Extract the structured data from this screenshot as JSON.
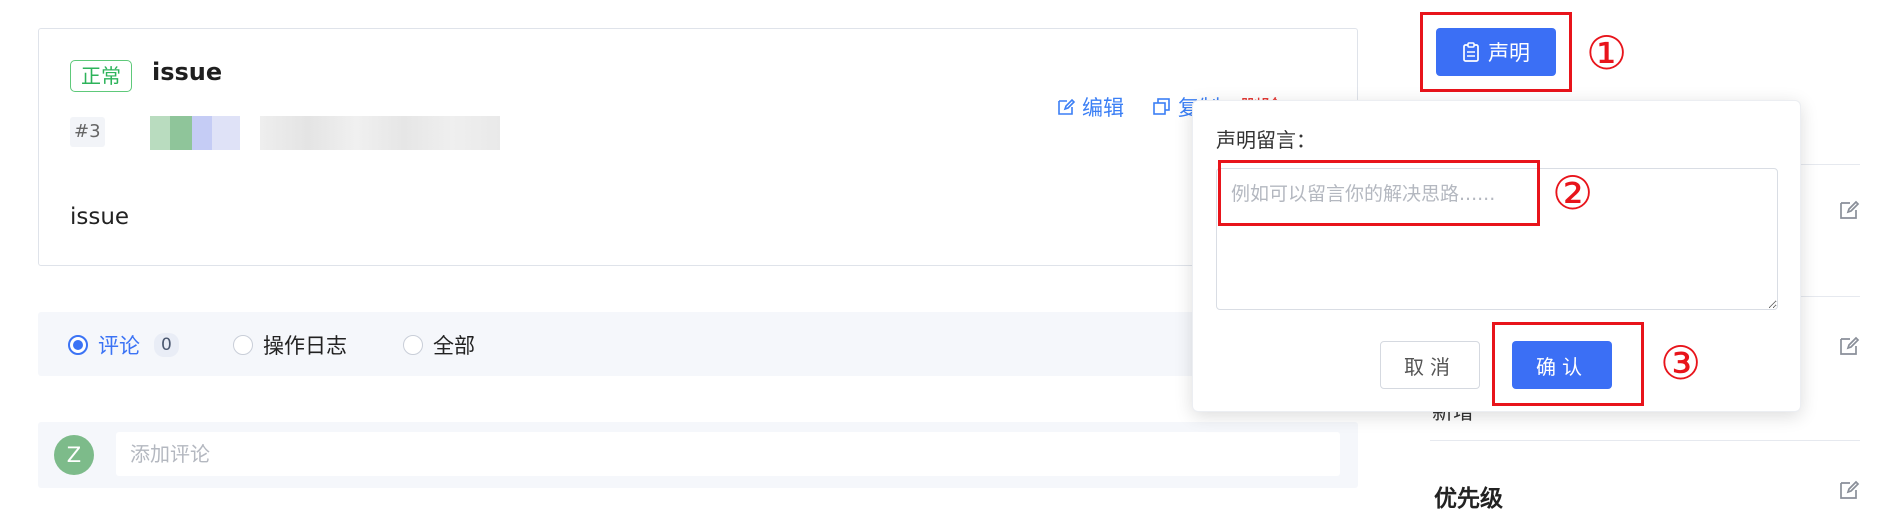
{
  "issue": {
    "status": "正常",
    "title": "issue",
    "number": "#3",
    "body": "issue",
    "edit_label": "编辑",
    "copy_label_partial": "复制",
    "red_action_partial": "删除"
  },
  "comments": {
    "tabs": [
      {
        "label": "评论",
        "count": "0",
        "selected": true
      },
      {
        "label": "操作日志",
        "selected": false
      },
      {
        "label": "全部",
        "selected": false
      }
    ],
    "avatar_letter": "Z",
    "input_placeholder": "添加评论"
  },
  "side_panel": {
    "fragment": "新增",
    "priority_label": "优先级"
  },
  "declare": {
    "button_label": "声明",
    "popover_label": "声明留言：",
    "placeholder": "例如可以留言你的解决思路......",
    "cancel_label": "取消",
    "confirm_label": "确认"
  },
  "annotations": {
    "marker_1": "①",
    "marker_2": "②",
    "marker_3": "③"
  },
  "colors": {
    "primary": "#3b6ff5",
    "status_green": "#2db35a",
    "annotation_red": "#e8141b"
  }
}
